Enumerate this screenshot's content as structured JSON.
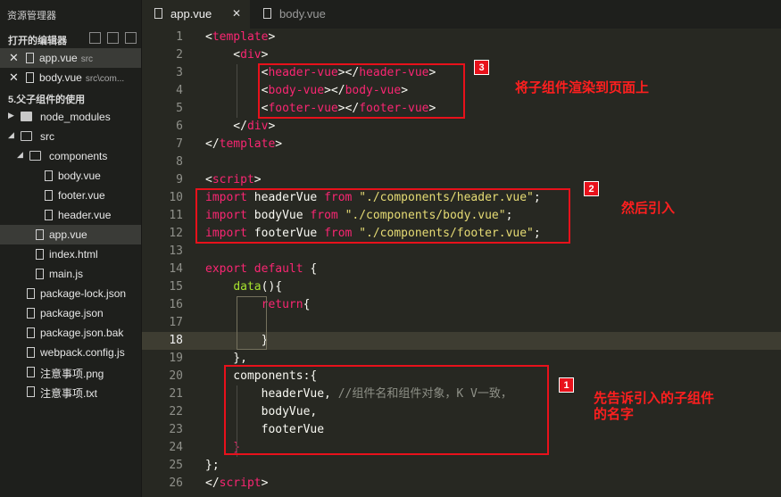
{
  "sidebar": {
    "title": "资源管理器",
    "open_editors": {
      "label": "打开的编辑器",
      "items": [
        {
          "name": "app.vue",
          "path": "src"
        },
        {
          "name": "body.vue",
          "path": "src\\com..."
        }
      ]
    },
    "project": {
      "label": "5.父子组件的使用",
      "items": [
        {
          "label": "node_modules"
        },
        {
          "label": "src"
        },
        {
          "label": "components"
        },
        {
          "label": "body.vue"
        },
        {
          "label": "footer.vue"
        },
        {
          "label": "header.vue"
        },
        {
          "label": "app.vue"
        },
        {
          "label": "index.html"
        },
        {
          "label": "main.js"
        },
        {
          "label": "package-lock.json"
        },
        {
          "label": "package.json"
        },
        {
          "label": "package.json.bak"
        },
        {
          "label": "webpack.config.js"
        },
        {
          "label": "注意事项.png"
        },
        {
          "label": "注意事项.txt"
        }
      ]
    }
  },
  "tabs": [
    {
      "label": "app.vue",
      "close": "✕"
    },
    {
      "label": "body.vue"
    }
  ],
  "editor": {
    "line_numbers": [
      "1",
      "2",
      "3",
      "4",
      "5",
      "6",
      "7",
      "8",
      "9",
      "10",
      "11",
      "12",
      "13",
      "14",
      "15",
      "16",
      "17",
      "18",
      "19",
      "20",
      "21",
      "22",
      "23",
      "24",
      "25",
      "26"
    ],
    "lines": [
      [
        {
          "t": "<",
          "c": "pl"
        },
        {
          "t": "template",
          "c": "tag"
        },
        {
          "t": ">",
          "c": "pl"
        }
      ],
      [
        {
          "t": "    <",
          "c": "pl"
        },
        {
          "t": "div",
          "c": "tag"
        },
        {
          "t": ">",
          "c": "pl"
        }
      ],
      [
        {
          "t": "        <",
          "c": "pl"
        },
        {
          "t": "header-vue",
          "c": "tag"
        },
        {
          "t": "></",
          "c": "pl"
        },
        {
          "t": "header-vue",
          "c": "tag"
        },
        {
          "t": ">",
          "c": "pl"
        }
      ],
      [
        {
          "t": "        <",
          "c": "pl"
        },
        {
          "t": "body-vue",
          "c": "tag"
        },
        {
          "t": "></",
          "c": "pl"
        },
        {
          "t": "body-vue",
          "c": "tag"
        },
        {
          "t": ">",
          "c": "pl"
        }
      ],
      [
        {
          "t": "        <",
          "c": "pl"
        },
        {
          "t": "footer-vue",
          "c": "tag"
        },
        {
          "t": "></",
          "c": "pl"
        },
        {
          "t": "footer-vue",
          "c": "tag"
        },
        {
          "t": ">",
          "c": "pl"
        }
      ],
      [
        {
          "t": "    </",
          "c": "pl"
        },
        {
          "t": "div",
          "c": "tag"
        },
        {
          "t": ">",
          "c": "pl"
        }
      ],
      [
        {
          "t": "</",
          "c": "pl"
        },
        {
          "t": "template",
          "c": "tag"
        },
        {
          "t": ">",
          "c": "pl"
        }
      ],
      [],
      [
        {
          "t": "<",
          "c": "pl"
        },
        {
          "t": "script",
          "c": "tag"
        },
        {
          "t": ">",
          "c": "pl"
        }
      ],
      [
        {
          "t": "import",
          "c": "kw"
        },
        {
          "t": " headerVue ",
          "c": "pl"
        },
        {
          "t": "from",
          "c": "kw"
        },
        {
          "t": " ",
          "c": "pl"
        },
        {
          "t": "\"./components/header.vue\"",
          "c": "str"
        },
        {
          "t": ";",
          "c": "pl"
        }
      ],
      [
        {
          "t": "import",
          "c": "kw"
        },
        {
          "t": " bodyVue ",
          "c": "pl"
        },
        {
          "t": "from",
          "c": "kw"
        },
        {
          "t": " ",
          "c": "pl"
        },
        {
          "t": "\"./components/body.vue\"",
          "c": "str"
        },
        {
          "t": ";",
          "c": "pl"
        }
      ],
      [
        {
          "t": "import",
          "c": "kw"
        },
        {
          "t": " footerVue ",
          "c": "pl"
        },
        {
          "t": "from",
          "c": "kw"
        },
        {
          "t": " ",
          "c": "pl"
        },
        {
          "t": "\"./components/footer.vue\"",
          "c": "str"
        },
        {
          "t": ";",
          "c": "pl"
        }
      ],
      [],
      [
        {
          "t": "export",
          "c": "kw"
        },
        {
          "t": " ",
          "c": "pl"
        },
        {
          "t": "default",
          "c": "kw"
        },
        {
          "t": " {",
          "c": "pl"
        }
      ],
      [
        {
          "t": "    ",
          "c": "pl"
        },
        {
          "t": "data",
          "c": "fn"
        },
        {
          "t": "(){",
          "c": "pl"
        }
      ],
      [
        {
          "t": "        ",
          "c": "pl"
        },
        {
          "t": "return",
          "c": "kw"
        },
        {
          "t": "{",
          "c": "pl"
        }
      ],
      [],
      [
        {
          "t": "        }",
          "c": "pl"
        }
      ],
      [
        {
          "t": "    },",
          "c": "pl"
        }
      ],
      [
        {
          "t": "    components:{",
          "c": "pl"
        }
      ],
      [
        {
          "t": "        headerVue, ",
          "c": "pl"
        },
        {
          "t": "//组件名和组件对象，K V一致，",
          "c": "cm"
        }
      ],
      [
        {
          "t": "        bodyVue,",
          "c": "pl"
        }
      ],
      [
        {
          "t": "        footerVue",
          "c": "pl"
        }
      ],
      [
        {
          "t": "    }",
          "c": "tag"
        }
      ],
      [
        {
          "t": "};",
          "c": "pl"
        }
      ],
      [
        {
          "t": "</",
          "c": "pl"
        },
        {
          "t": "script",
          "c": "tag"
        },
        {
          "t": ">",
          "c": "pl"
        }
      ]
    ]
  },
  "annotations": [
    {
      "badge": "3",
      "note": "将子组件渲染到页面上"
    },
    {
      "badge": "2",
      "note": "然后引入"
    },
    {
      "badge": "1",
      "note": "先告诉引入的子组件\n的名字"
    }
  ],
  "colors": {
    "annotation_red": "#e8111b",
    "tag": "#f92672",
    "string": "#e6db74",
    "function": "#a6e22e",
    "comment": "#8e9087"
  }
}
